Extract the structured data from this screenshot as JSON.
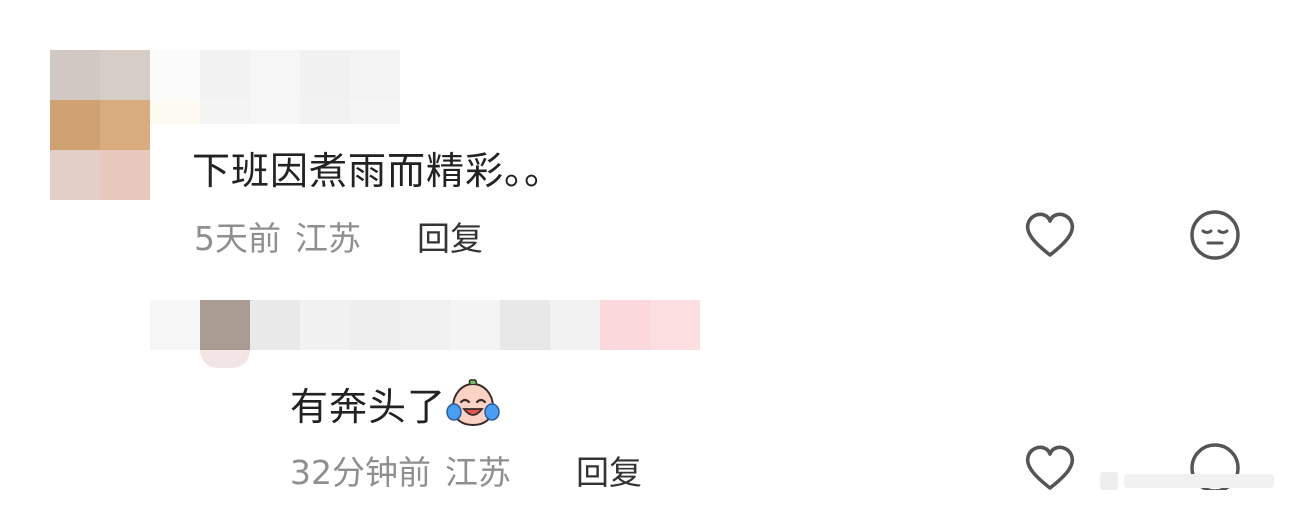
{
  "comments": [
    {
      "text": "下班因煮雨而精彩。。",
      "time": "5天前",
      "location": "江苏",
      "reply_label": "回复",
      "like_icon": "heart-outline-icon",
      "react_icon": "expressionless-face-icon"
    },
    {
      "text": "有奔头了",
      "emoji": "crying-laughing-face-emoji",
      "time": "32分钟前",
      "location": "江苏",
      "reply_label": "回复",
      "like_icon": "heart-outline-icon",
      "react_icon": "face-icon"
    }
  ],
  "colors": {
    "text": "#222222",
    "meta": "#8f8f8f",
    "icon": "#555555"
  }
}
